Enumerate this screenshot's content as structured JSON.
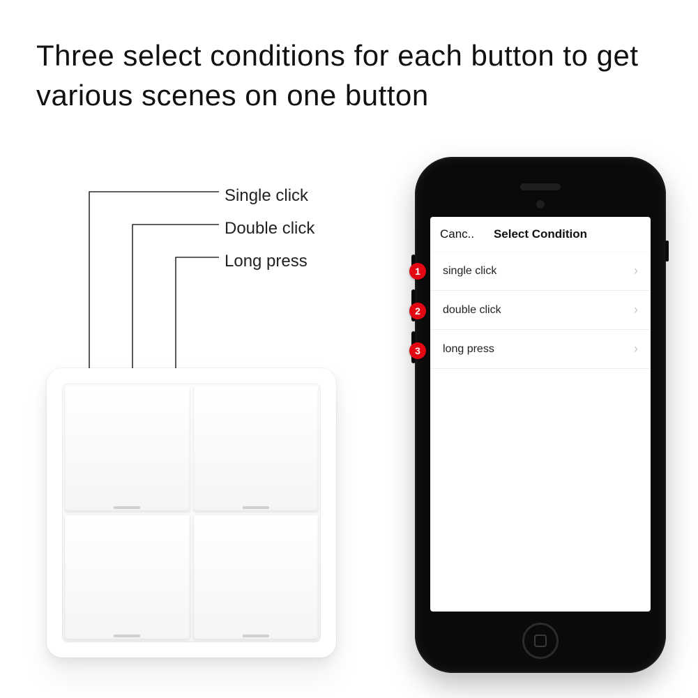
{
  "headline": "Three select conditions for each button to get various scenes on one button",
  "callout_labels": {
    "single": "Single click",
    "double": "Double click",
    "long": "Long press"
  },
  "phone": {
    "nav_cancel": "Canc..",
    "nav_title": "Select Condition",
    "rows": [
      {
        "label": "single click"
      },
      {
        "label": "double click"
      },
      {
        "label": "long press"
      }
    ],
    "badges": [
      "1",
      "2",
      "3"
    ]
  }
}
